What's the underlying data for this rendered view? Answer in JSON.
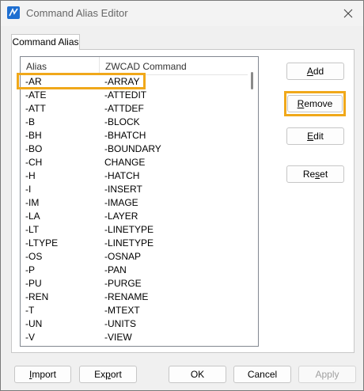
{
  "window": {
    "title": "Command Alias Editor"
  },
  "tabs": [
    {
      "label": "Command Alias"
    }
  ],
  "list": {
    "headers": {
      "alias": "Alias",
      "command": "ZWCAD Command"
    },
    "rows": [
      {
        "alias": "-AR",
        "command": "-ARRAY"
      },
      {
        "alias": "-ATE",
        "command": "-ATTEDIT"
      },
      {
        "alias": "-ATT",
        "command": "-ATTDEF"
      },
      {
        "alias": "-B",
        "command": "-BLOCK"
      },
      {
        "alias": "-BH",
        "command": "-BHATCH"
      },
      {
        "alias": "-BO",
        "command": "-BOUNDARY"
      },
      {
        "alias": "-CH",
        "command": "CHANGE"
      },
      {
        "alias": "-H",
        "command": "-HATCH"
      },
      {
        "alias": "-I",
        "command": "-INSERT"
      },
      {
        "alias": "-IM",
        "command": "-IMAGE"
      },
      {
        "alias": "-LA",
        "command": "-LAYER"
      },
      {
        "alias": "-LT",
        "command": "-LINETYPE"
      },
      {
        "alias": "-LTYPE",
        "command": "-LINETYPE"
      },
      {
        "alias": "-OS",
        "command": "-OSNAP"
      },
      {
        "alias": "-P",
        "command": "-PAN"
      },
      {
        "alias": "-PU",
        "command": "-PURGE"
      },
      {
        "alias": "-REN",
        "command": "-RENAME"
      },
      {
        "alias": "-T",
        "command": "-MTEXT"
      },
      {
        "alias": "-UN",
        "command": "-UNITS"
      },
      {
        "alias": "-V",
        "command": "-VIEW"
      }
    ]
  },
  "side_buttons": {
    "add": {
      "pre": "",
      "key": "A",
      "post": "dd"
    },
    "remove": {
      "pre": "",
      "key": "R",
      "post": "emove"
    },
    "edit": {
      "pre": "",
      "key": "E",
      "post": "dit"
    },
    "reset": {
      "pre": "Re",
      "key": "s",
      "post": "et"
    }
  },
  "bottom_buttons": {
    "import": {
      "pre": "",
      "key": "I",
      "post": "mport"
    },
    "export": {
      "pre": "Ex",
      "key": "p",
      "post": "ort"
    },
    "ok": "OK",
    "cancel": "Cancel",
    "apply": "Apply"
  },
  "colors": {
    "highlight": "#f0a81a",
    "app_icon": "#1f6fd1"
  },
  "icons": {
    "app": "zwcad-app-icon",
    "close": "close-icon"
  }
}
